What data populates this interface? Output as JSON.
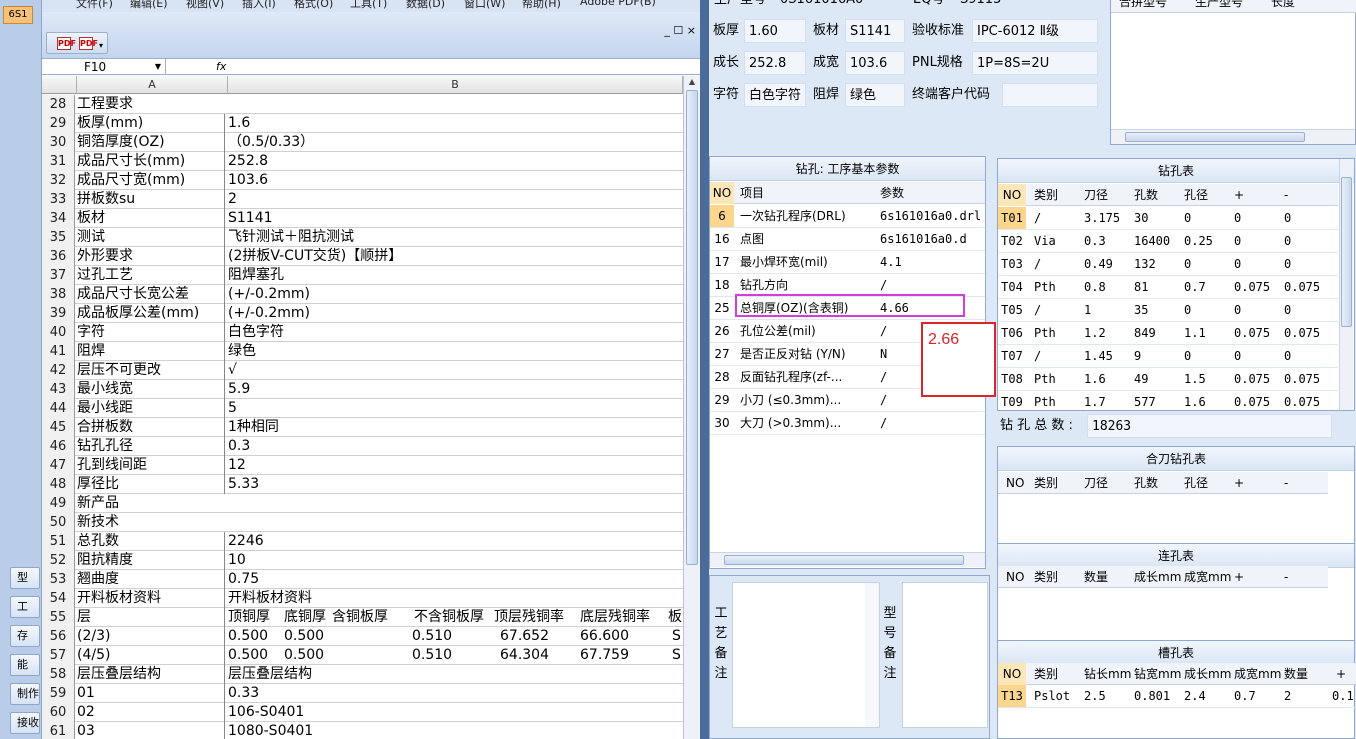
{
  "left_strip": {
    "top_tab": "6S1",
    "buttons": [
      "型",
      "工",
      "存",
      "能",
      "制作",
      "接收"
    ]
  },
  "excel": {
    "menu": [
      "文件(F)",
      "编辑(E)",
      "视图(V)",
      "插入(I)",
      "格式(O)",
      "工具(T)",
      "数据(D)",
      "窗口(W)",
      "帮助(H)",
      "Adobe PDF(B)"
    ],
    "win_controls": "_ ☐ ×",
    "cell_ref": "F10",
    "fx": "fx",
    "col_a": "A",
    "col_b": "B",
    "rows": [
      {
        "n": "28",
        "a": "工程要求",
        "b": ""
      },
      {
        "n": "29",
        "a": "板厚(mm)",
        "b": "1.6"
      },
      {
        "n": "30",
        "a": "铜箔厚度(OZ)",
        "b": "（0.5/0.33）"
      },
      {
        "n": "31",
        "a": "成品尺寸长(mm)",
        "b": "252.8"
      },
      {
        "n": "32",
        "a": "成品尺寸宽(mm)",
        "b": "103.6"
      },
      {
        "n": "33",
        "a": "拼板数su",
        "b": "2"
      },
      {
        "n": "34",
        "a": "板材",
        "b": "S1141"
      },
      {
        "n": "35",
        "a": "测试",
        "b": "飞针测试＋阻抗测试"
      },
      {
        "n": "36",
        "a": "外形要求",
        "b": "(2拼板V-CUT交货)【顺拼】"
      },
      {
        "n": "37",
        "a": "过孔工艺",
        "b": "阻焊塞孔"
      },
      {
        "n": "38",
        "a": "成品尺寸长宽公差",
        "b": "(+/-0.2mm)"
      },
      {
        "n": "39",
        "a": "成品板厚公差(mm)",
        "b": "(+/-0.2mm)"
      },
      {
        "n": "40",
        "a": "字符",
        "b": "白色字符"
      },
      {
        "n": "41",
        "a": "阻焊",
        "b": "绿色"
      },
      {
        "n": "42",
        "a": "层压不可更改",
        "b": "√"
      },
      {
        "n": "43",
        "a": "最小线宽",
        "b": "5.9"
      },
      {
        "n": "44",
        "a": "最小线距",
        "b": "5"
      },
      {
        "n": "45",
        "a": "合拼板数",
        "b": "1种相同"
      },
      {
        "n": "46",
        "a": "钻孔孔径",
        "b": "0.3"
      },
      {
        "n": "47",
        "a": "孔到线间距",
        "b": "12"
      },
      {
        "n": "48",
        "a": "厚径比",
        "b": "5.33"
      },
      {
        "n": "49",
        "a": "新产品",
        "b": ""
      },
      {
        "n": "50",
        "a": "新技术",
        "b": ""
      },
      {
        "n": "51",
        "a": "总孔数",
        "b": "2246"
      },
      {
        "n": "52",
        "a": "阻抗精度",
        "b": "10"
      },
      {
        "n": "53",
        "a": "翘曲度",
        "b": "0.75"
      },
      {
        "n": "54",
        "a": "开料板材资料",
        "b": "开料板材资料"
      },
      {
        "n": "55",
        "a": "层",
        "b": ""
      },
      {
        "n": "56",
        "a": "(2/3)",
        "b": ""
      },
      {
        "n": "57",
        "a": "(4/5)",
        "b": ""
      },
      {
        "n": "58",
        "a": "层压叠层结构",
        "b": "层压叠层结构"
      },
      {
        "n": "59",
        "a": "01",
        "b": "0.33"
      },
      {
        "n": "60",
        "a": "02",
        "b": "106-S0401"
      },
      {
        "n": "61",
        "a": "03",
        "b": "1080-S0401"
      }
    ],
    "row55_cells": [
      "顶铜厚",
      "底铜厚",
      "含铜板厚",
      "不含铜板厚",
      "顶层残铜率",
      "底层残铜率",
      "板"
    ],
    "row56_cells": [
      "0.500",
      "0.500",
      "0.510",
      "67.652",
      "66.600",
      "S"
    ],
    "row57_cells": [
      "0.500",
      "0.500",
      "0.510",
      "64.304",
      "67.759",
      "S"
    ]
  },
  "info": {
    "top_labels": [
      "生产型号",
      "0S161016A0",
      "EQ号",
      "S9115"
    ],
    "thickness_label": "板厚",
    "thickness": "1.60",
    "material_label": "板材",
    "material": "S1141",
    "standard_label": "验收标准",
    "standard": "IPC-6012 Ⅱ级",
    "length_label": "成长",
    "length": "252.8",
    "width_label": "成宽",
    "width": "103.6",
    "pnl_label": "PNL规格",
    "pnl": "1P=8S=2U",
    "char_label": "字符",
    "char": "白色字符",
    "mask_label": "阻焊",
    "mask": "绿色",
    "customer_label": "终端客户代码",
    "customer": ""
  },
  "top_right_headers": [
    "合拼型号",
    "生产型号",
    "长度"
  ],
  "params": {
    "title": "钻孔: 工序基本参数",
    "headers": [
      "NO",
      "项目",
      "参数"
    ],
    "rows": [
      {
        "no": "6",
        "item": "一次钻孔程序(DRL)",
        "val": "6s161016a0.drl"
      },
      {
        "no": "16",
        "item": "点图",
        "val": "6s161016a0.d"
      },
      {
        "no": "17",
        "item": "最小焊环宽(mil)",
        "val": "4.1"
      },
      {
        "no": "18",
        "item": "钻孔方向",
        "val": "/"
      },
      {
        "no": "25",
        "item": "总铜厚(OZ)(含表铜)",
        "val": "4.66"
      },
      {
        "no": "26",
        "item": "孔位公差(mil)",
        "val": "/"
      },
      {
        "no": "27",
        "item": "是否正反对钻 (Y/N)",
        "val": "N"
      },
      {
        "no": "28",
        "item": "反面钻孔程序(zf-...",
        "val": "/"
      },
      {
        "no": "29",
        "item": "小刀 (≤0.3mm)...",
        "val": "/"
      },
      {
        "no": "30",
        "item": "大刀 (>0.3mm)...",
        "val": "/"
      }
    ]
  },
  "annotation": "2.66",
  "drill": {
    "title": "钻孔表",
    "headers": [
      "NO",
      "类别",
      "刀径",
      "孔数",
      "孔径",
      "+",
      "-"
    ],
    "rows": [
      [
        "T01",
        "/",
        "3.175",
        "30",
        "0",
        "0",
        "0"
      ],
      [
        "T02",
        "Via",
        "0.3",
        "16400",
        "0.25",
        "0",
        "0"
      ],
      [
        "T03",
        "/",
        "0.49",
        "132",
        "0",
        "0",
        "0"
      ],
      [
        "T04",
        "Pth",
        "0.8",
        "81",
        "0.7",
        "0.075",
        "0.075"
      ],
      [
        "T05",
        "/",
        "1",
        "35",
        "0",
        "0",
        "0"
      ],
      [
        "T06",
        "Pth",
        "1.2",
        "849",
        "1.1",
        "0.075",
        "0.075"
      ],
      [
        "T07",
        "/",
        "1.45",
        "9",
        "0",
        "0",
        "0"
      ],
      [
        "T08",
        "Pth",
        "1.6",
        "49",
        "1.5",
        "0.075",
        "0.075"
      ],
      [
        "T09",
        "Pth",
        "1.7",
        "577",
        "1.6",
        "0.075",
        "0.075"
      ]
    ],
    "total_label": "钻 孔 总 数 :",
    "total": "18263"
  },
  "combo": {
    "title": "合刀钻孔表",
    "headers": [
      "NO",
      "类别",
      "刀径",
      "孔数",
      "孔径",
      "+",
      "-"
    ]
  },
  "conn": {
    "title": "连孔表",
    "headers": [
      "NO",
      "类别",
      "数量",
      "成长mm",
      "成宽mm",
      "+",
      "-"
    ]
  },
  "slot": {
    "title": "槽孔表",
    "headers": [
      "NO",
      "类别",
      "钻长mm",
      "钻宽mm",
      "成长mm",
      "成宽mm",
      "数量",
      "+"
    ],
    "row": [
      "T13",
      "Pslot",
      "2.5",
      "0.801",
      "2.4",
      "0.7",
      "2",
      "0.1"
    ]
  },
  "memo": {
    "process_label": "工艺备注",
    "model_label": "型号备注"
  }
}
